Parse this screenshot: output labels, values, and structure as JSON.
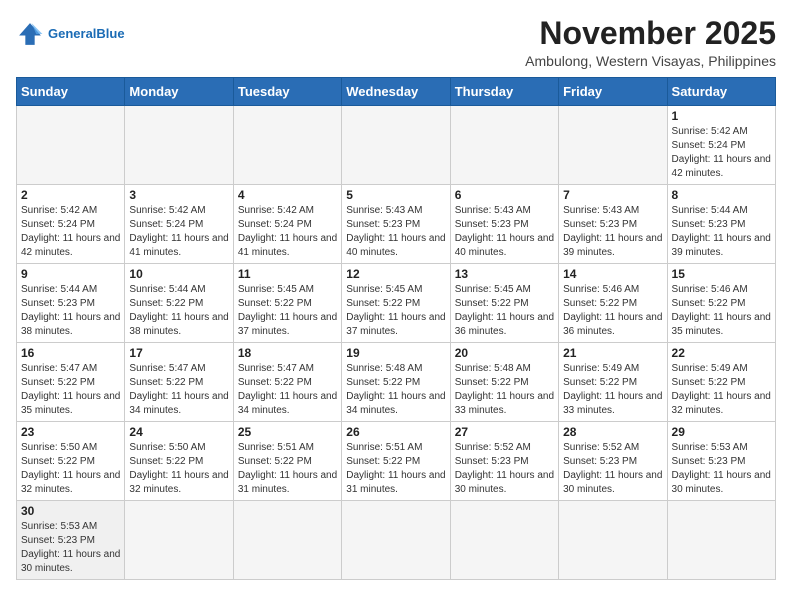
{
  "header": {
    "logo_general": "General",
    "logo_blue": "Blue",
    "month_title": "November 2025",
    "location": "Ambulong, Western Visayas, Philippines"
  },
  "weekdays": [
    "Sunday",
    "Monday",
    "Tuesday",
    "Wednesday",
    "Thursday",
    "Friday",
    "Saturday"
  ],
  "weeks": [
    [
      {
        "day": "",
        "sunrise": "",
        "sunset": "",
        "daylight": "",
        "empty": true
      },
      {
        "day": "",
        "sunrise": "",
        "sunset": "",
        "daylight": "",
        "empty": true
      },
      {
        "day": "",
        "sunrise": "",
        "sunset": "",
        "daylight": "",
        "empty": true
      },
      {
        "day": "",
        "sunrise": "",
        "sunset": "",
        "daylight": "",
        "empty": true
      },
      {
        "day": "",
        "sunrise": "",
        "sunset": "",
        "daylight": "",
        "empty": true
      },
      {
        "day": "",
        "sunrise": "",
        "sunset": "",
        "daylight": "",
        "empty": true
      },
      {
        "day": "1",
        "sunrise": "Sunrise: 5:42 AM",
        "sunset": "Sunset: 5:24 PM",
        "daylight": "Daylight: 11 hours and 42 minutes.",
        "empty": false
      }
    ],
    [
      {
        "day": "2",
        "sunrise": "Sunrise: 5:42 AM",
        "sunset": "Sunset: 5:24 PM",
        "daylight": "Daylight: 11 hours and 42 minutes.",
        "empty": false
      },
      {
        "day": "3",
        "sunrise": "Sunrise: 5:42 AM",
        "sunset": "Sunset: 5:24 PM",
        "daylight": "Daylight: 11 hours and 41 minutes.",
        "empty": false
      },
      {
        "day": "4",
        "sunrise": "Sunrise: 5:42 AM",
        "sunset": "Sunset: 5:24 PM",
        "daylight": "Daylight: 11 hours and 41 minutes.",
        "empty": false
      },
      {
        "day": "5",
        "sunrise": "Sunrise: 5:43 AM",
        "sunset": "Sunset: 5:23 PM",
        "daylight": "Daylight: 11 hours and 40 minutes.",
        "empty": false
      },
      {
        "day": "6",
        "sunrise": "Sunrise: 5:43 AM",
        "sunset": "Sunset: 5:23 PM",
        "daylight": "Daylight: 11 hours and 40 minutes.",
        "empty": false
      },
      {
        "day": "7",
        "sunrise": "Sunrise: 5:43 AM",
        "sunset": "Sunset: 5:23 PM",
        "daylight": "Daylight: 11 hours and 39 minutes.",
        "empty": false
      },
      {
        "day": "8",
        "sunrise": "Sunrise: 5:44 AM",
        "sunset": "Sunset: 5:23 PM",
        "daylight": "Daylight: 11 hours and 39 minutes.",
        "empty": false
      }
    ],
    [
      {
        "day": "9",
        "sunrise": "Sunrise: 5:44 AM",
        "sunset": "Sunset: 5:23 PM",
        "daylight": "Daylight: 11 hours and 38 minutes.",
        "empty": false
      },
      {
        "day": "10",
        "sunrise": "Sunrise: 5:44 AM",
        "sunset": "Sunset: 5:22 PM",
        "daylight": "Daylight: 11 hours and 38 minutes.",
        "empty": false
      },
      {
        "day": "11",
        "sunrise": "Sunrise: 5:45 AM",
        "sunset": "Sunset: 5:22 PM",
        "daylight": "Daylight: 11 hours and 37 minutes.",
        "empty": false
      },
      {
        "day": "12",
        "sunrise": "Sunrise: 5:45 AM",
        "sunset": "Sunset: 5:22 PM",
        "daylight": "Daylight: 11 hours and 37 minutes.",
        "empty": false
      },
      {
        "day": "13",
        "sunrise": "Sunrise: 5:45 AM",
        "sunset": "Sunset: 5:22 PM",
        "daylight": "Daylight: 11 hours and 36 minutes.",
        "empty": false
      },
      {
        "day": "14",
        "sunrise": "Sunrise: 5:46 AM",
        "sunset": "Sunset: 5:22 PM",
        "daylight": "Daylight: 11 hours and 36 minutes.",
        "empty": false
      },
      {
        "day": "15",
        "sunrise": "Sunrise: 5:46 AM",
        "sunset": "Sunset: 5:22 PM",
        "daylight": "Daylight: 11 hours and 35 minutes.",
        "empty": false
      }
    ],
    [
      {
        "day": "16",
        "sunrise": "Sunrise: 5:47 AM",
        "sunset": "Sunset: 5:22 PM",
        "daylight": "Daylight: 11 hours and 35 minutes.",
        "empty": false
      },
      {
        "day": "17",
        "sunrise": "Sunrise: 5:47 AM",
        "sunset": "Sunset: 5:22 PM",
        "daylight": "Daylight: 11 hours and 34 minutes.",
        "empty": false
      },
      {
        "day": "18",
        "sunrise": "Sunrise: 5:47 AM",
        "sunset": "Sunset: 5:22 PM",
        "daylight": "Daylight: 11 hours and 34 minutes.",
        "empty": false
      },
      {
        "day": "19",
        "sunrise": "Sunrise: 5:48 AM",
        "sunset": "Sunset: 5:22 PM",
        "daylight": "Daylight: 11 hours and 34 minutes.",
        "empty": false
      },
      {
        "day": "20",
        "sunrise": "Sunrise: 5:48 AM",
        "sunset": "Sunset: 5:22 PM",
        "daylight": "Daylight: 11 hours and 33 minutes.",
        "empty": false
      },
      {
        "day": "21",
        "sunrise": "Sunrise: 5:49 AM",
        "sunset": "Sunset: 5:22 PM",
        "daylight": "Daylight: 11 hours and 33 minutes.",
        "empty": false
      },
      {
        "day": "22",
        "sunrise": "Sunrise: 5:49 AM",
        "sunset": "Sunset: 5:22 PM",
        "daylight": "Daylight: 11 hours and 32 minutes.",
        "empty": false
      }
    ],
    [
      {
        "day": "23",
        "sunrise": "Sunrise: 5:50 AM",
        "sunset": "Sunset: 5:22 PM",
        "daylight": "Daylight: 11 hours and 32 minutes.",
        "empty": false
      },
      {
        "day": "24",
        "sunrise": "Sunrise: 5:50 AM",
        "sunset": "Sunset: 5:22 PM",
        "daylight": "Daylight: 11 hours and 32 minutes.",
        "empty": false
      },
      {
        "day": "25",
        "sunrise": "Sunrise: 5:51 AM",
        "sunset": "Sunset: 5:22 PM",
        "daylight": "Daylight: 11 hours and 31 minutes.",
        "empty": false
      },
      {
        "day": "26",
        "sunrise": "Sunrise: 5:51 AM",
        "sunset": "Sunset: 5:22 PM",
        "daylight": "Daylight: 11 hours and 31 minutes.",
        "empty": false
      },
      {
        "day": "27",
        "sunrise": "Sunrise: 5:52 AM",
        "sunset": "Sunset: 5:23 PM",
        "daylight": "Daylight: 11 hours and 30 minutes.",
        "empty": false
      },
      {
        "day": "28",
        "sunrise": "Sunrise: 5:52 AM",
        "sunset": "Sunset: 5:23 PM",
        "daylight": "Daylight: 11 hours and 30 minutes.",
        "empty": false
      },
      {
        "day": "29",
        "sunrise": "Sunrise: 5:53 AM",
        "sunset": "Sunset: 5:23 PM",
        "daylight": "Daylight: 11 hours and 30 minutes.",
        "empty": false
      }
    ],
    [
      {
        "day": "30",
        "sunrise": "Sunrise: 5:53 AM",
        "sunset": "Sunset: 5:23 PM",
        "daylight": "Daylight: 11 hours and 30 minutes.",
        "empty": false,
        "last": true
      },
      {
        "day": "",
        "sunrise": "",
        "sunset": "",
        "daylight": "",
        "empty": true,
        "last": true
      },
      {
        "day": "",
        "sunrise": "",
        "sunset": "",
        "daylight": "",
        "empty": true,
        "last": true
      },
      {
        "day": "",
        "sunrise": "",
        "sunset": "",
        "daylight": "",
        "empty": true,
        "last": true
      },
      {
        "day": "",
        "sunrise": "",
        "sunset": "",
        "daylight": "",
        "empty": true,
        "last": true
      },
      {
        "day": "",
        "sunrise": "",
        "sunset": "",
        "daylight": "",
        "empty": true,
        "last": true
      },
      {
        "day": "",
        "sunrise": "",
        "sunset": "",
        "daylight": "",
        "empty": true,
        "last": true
      }
    ]
  ]
}
